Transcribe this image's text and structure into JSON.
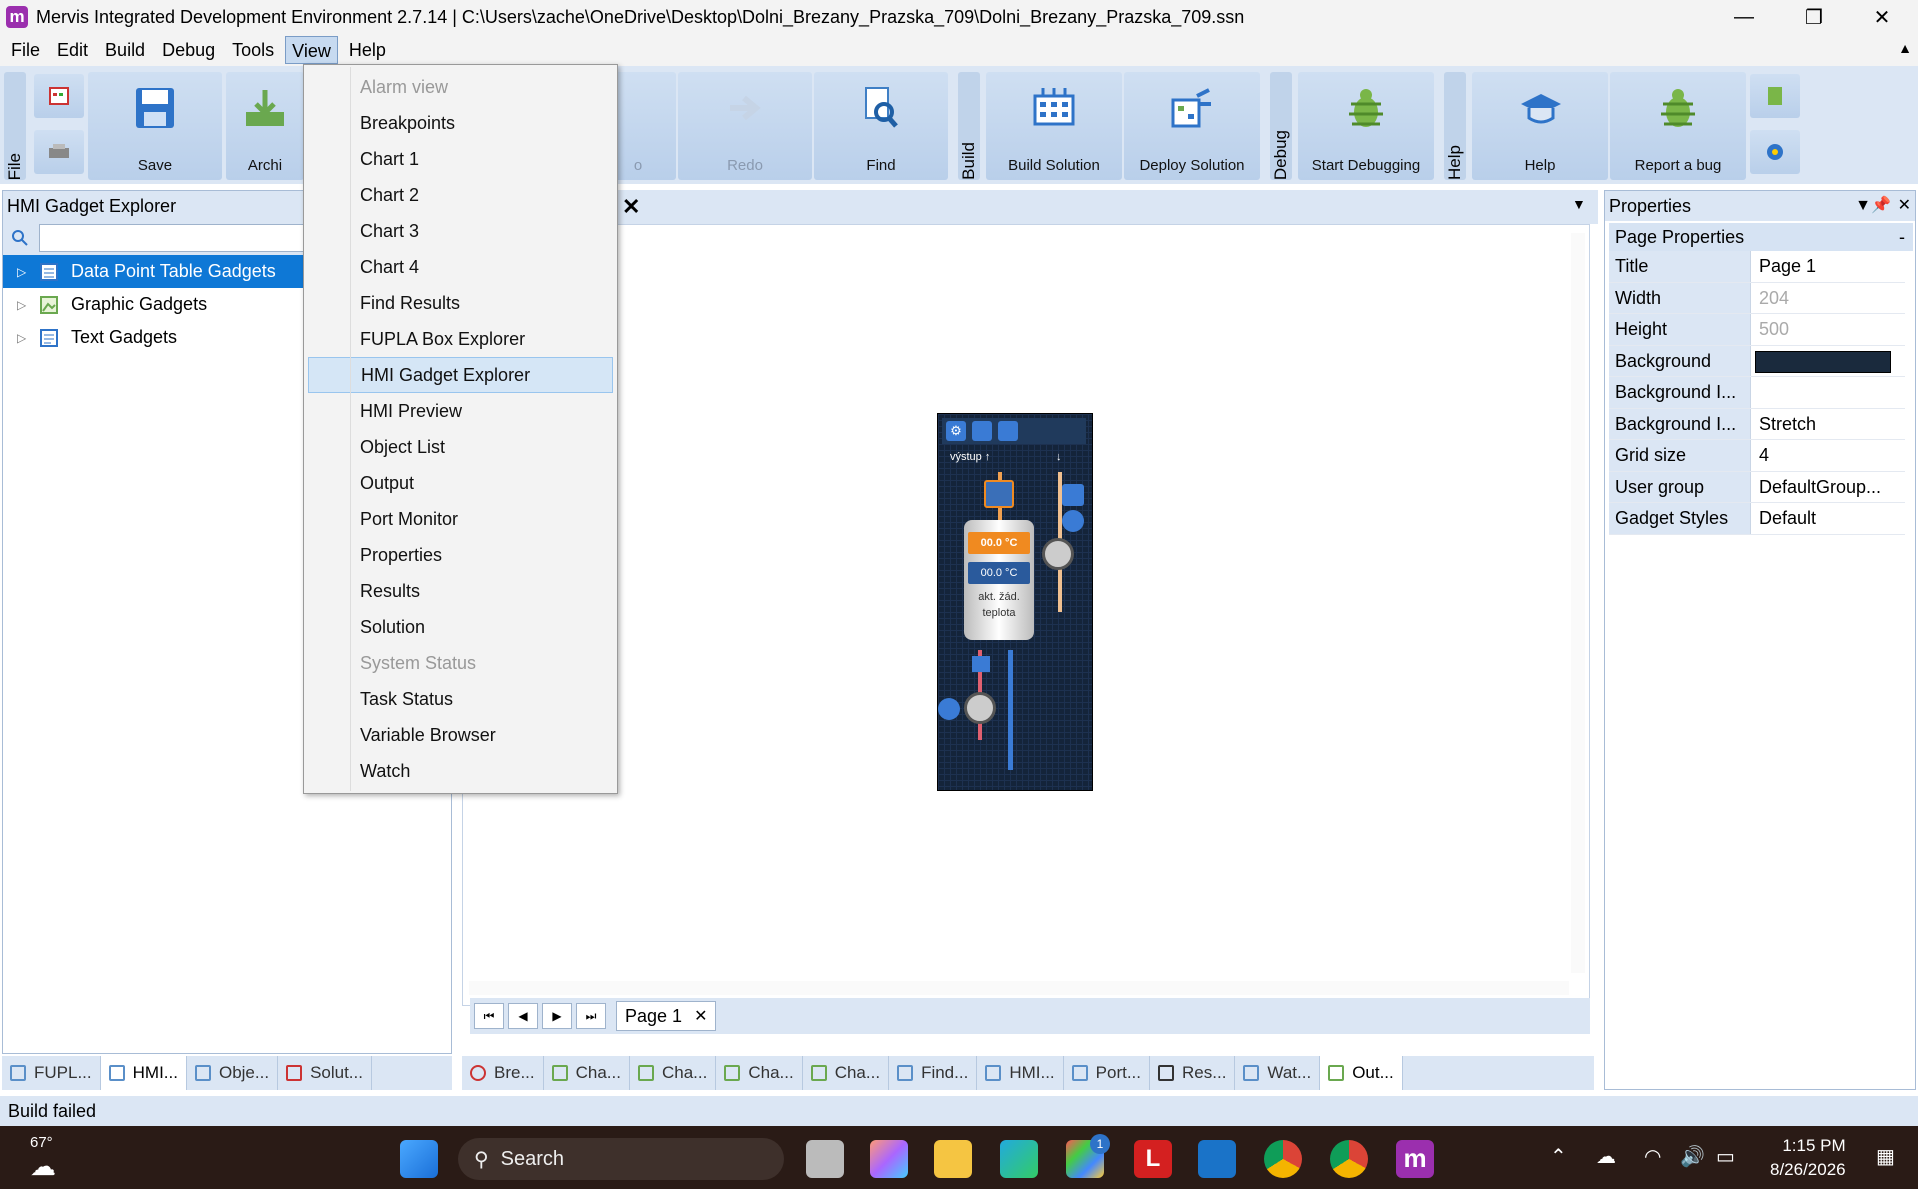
{
  "titlebar": {
    "title": "Mervis Integrated Development Environment 2.7.14 | C:\\Users\\zache\\OneDrive\\Desktop\\Dolni_Brezany_Prazska_709\\Dolni_Brezany_Prazska_709.ssn",
    "logo_letter": "m"
  },
  "menubar": [
    "File",
    "Edit",
    "Build",
    "Debug",
    "Tools",
    "View",
    "Help"
  ],
  "ribbon": {
    "groups": {
      "file": "File",
      "build": "Build",
      "debug": "Debug",
      "help": "Help"
    },
    "buttons": {
      "save": "Save",
      "archive": "Archi",
      "undo": "o",
      "redo": "Redo",
      "find": "Find",
      "build_solution": "Build Solution",
      "deploy_solution": "Deploy Solution",
      "start_debugging": "Start Debugging",
      "help": "Help",
      "report_bug": "Report a bug"
    }
  },
  "left_panel": {
    "title": "HMI Gadget Explorer",
    "tree": [
      "Data Point Table Gadgets",
      "Graphic Gadgets",
      "Text Gadgets"
    ],
    "bottom_tabs": [
      "FUPL...",
      "HMI...",
      "Obje...",
      "Solut..."
    ]
  },
  "view_menu": [
    {
      "label": "Alarm view",
      "disabled": true
    },
    {
      "label": "Breakpoints"
    },
    {
      "label": "Chart 1"
    },
    {
      "label": "Chart 2"
    },
    {
      "label": "Chart 3"
    },
    {
      "label": "Chart 4"
    },
    {
      "label": "Find Results"
    },
    {
      "label": "FUPLA Box Explorer"
    },
    {
      "label": "HMI Gadget Explorer",
      "hover": true
    },
    {
      "label": "HMI Preview"
    },
    {
      "label": "Object List"
    },
    {
      "label": "Output"
    },
    {
      "label": "Port Monitor"
    },
    {
      "label": "Properties"
    },
    {
      "label": "Results"
    },
    {
      "label": "Solution"
    },
    {
      "label": "System Status",
      "disabled": true
    },
    {
      "label": "Task Status"
    },
    {
      "label": "Variable Browser"
    },
    {
      "label": "Watch"
    }
  ],
  "document": {
    "page_tab": "Page 1",
    "hmi": {
      "label_out": "výstup",
      "temp1": "00.0 °C",
      "temp2": "00.0 °C",
      "caption1": "akt. žád.",
      "caption2": "teplota"
    }
  },
  "bottom_tabs": [
    "Bre...",
    "Cha...",
    "Cha...",
    "Cha...",
    "Cha...",
    "Find...",
    "HMI...",
    "Port...",
    "Res...",
    "Wat...",
    "Out..."
  ],
  "properties": {
    "title": "Properties",
    "group": "Page Properties",
    "rows": [
      {
        "name": "Title",
        "value": "Page 1"
      },
      {
        "name": "Width",
        "value": "204",
        "disabled": true
      },
      {
        "name": "Height",
        "value": "500",
        "disabled": true
      },
      {
        "name": "Background",
        "value": ""
      },
      {
        "name": "Background I...",
        "value": ""
      },
      {
        "name": "Background I...",
        "value": "Stretch"
      },
      {
        "name": "Grid size",
        "value": "4"
      },
      {
        "name": "User group",
        "value": "DefaultGroup..."
      },
      {
        "name": "Gadget Styles",
        "value": "Default"
      }
    ],
    "background_color": "#1a2a3d"
  },
  "statusbar": "Build failed",
  "taskbar": {
    "weather": "67°",
    "search": "Search",
    "store_badge": "1",
    "time": "1:15 PM",
    "date": "8/26/2026"
  }
}
